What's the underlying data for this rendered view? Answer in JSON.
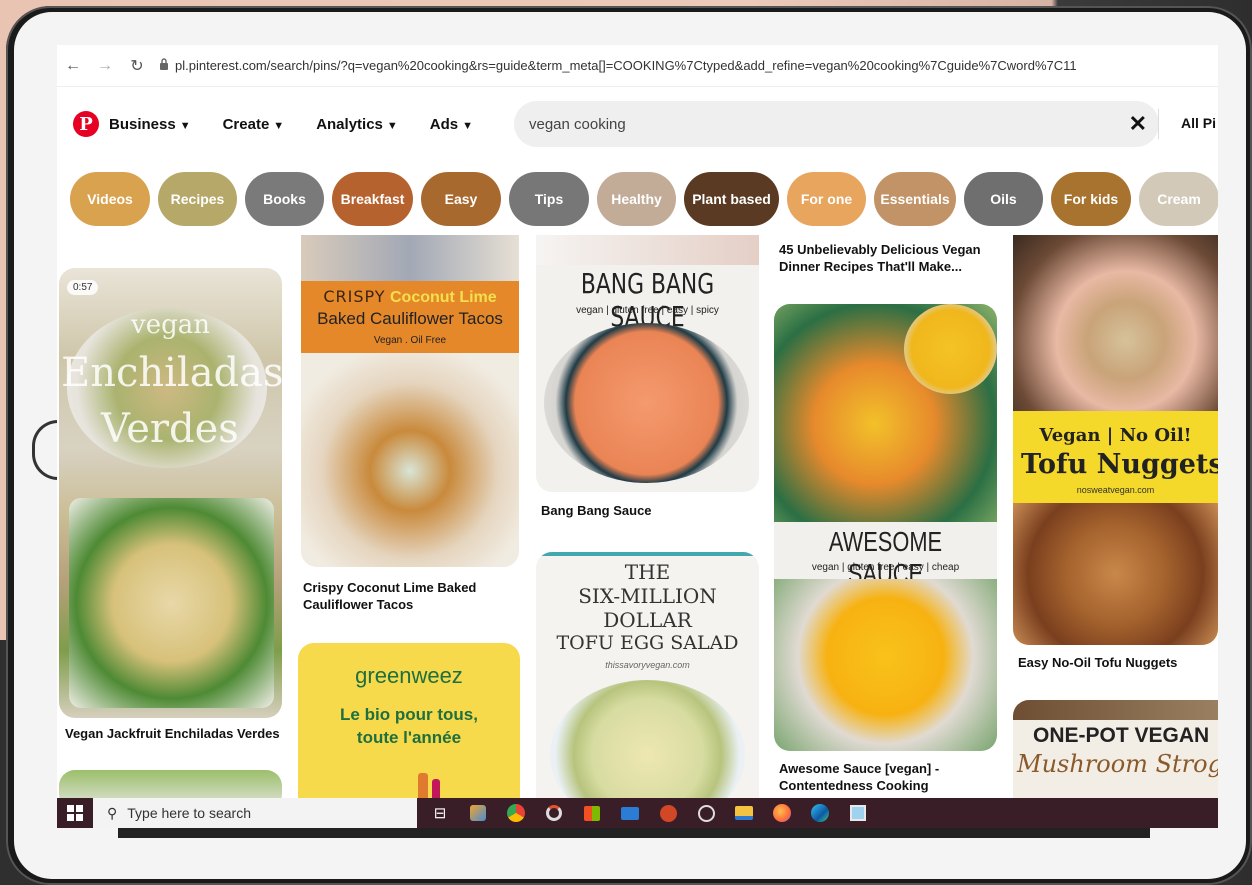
{
  "browser": {
    "url": "pl.pinterest.com/search/pins/?q=vegan%20cooking&rs=guide&term_meta[]=COOKING%7Ctyped&add_refine=vegan%20cooking%7Cguide%7Cword%7C11",
    "back": "←",
    "forward": "→",
    "reload": "↻"
  },
  "header": {
    "logo": "P",
    "menu": [
      "Business",
      "Create",
      "Analytics",
      "Ads"
    ],
    "search_value": "vegan cooking",
    "clear": "✕",
    "all_pins": "All Pi"
  },
  "chips": [
    {
      "label": "Videos",
      "color": "#d9a24f"
    },
    {
      "label": "Recipes",
      "color": "#b5a868"
    },
    {
      "label": "Books",
      "color": "#7a7a7a"
    },
    {
      "label": "Breakfast",
      "color": "#b5622e"
    },
    {
      "label": "Easy",
      "color": "#a8692f"
    },
    {
      "label": "Tips",
      "color": "#777777"
    },
    {
      "label": "Healthy",
      "color": "#c2ab97"
    },
    {
      "label": "Plant based",
      "color": "#5a3a22"
    },
    {
      "label": "For one",
      "color": "#e8a55e"
    },
    {
      "label": "Essentials",
      "color": "#c29366"
    },
    {
      "label": "Oils",
      "color": "#6f6f6f"
    },
    {
      "label": "For kids",
      "color": "#a8732f"
    },
    {
      "label": "Cream",
      "color": "#d3c9b9"
    }
  ],
  "pins": {
    "enchiladas": {
      "badge": "0:57",
      "overlay1": "vegan",
      "overlay2": "Enchiladas",
      "overlay3": "Verdes",
      "title": "Vegan Jackfruit Enchiladas Verdes"
    },
    "tacos": {
      "line1a": "CRISPY",
      "line1b": "Coconut Lime",
      "line2": "Baked Cauliflower Tacos",
      "line3": "Vegan . Oil Free",
      "title": "Crispy Coconut Lime Baked Cauliflower Tacos"
    },
    "ad": {
      "brand": "greenweez",
      "line1": "Le bio pour tous,",
      "line2": "toute l'année"
    },
    "bangbang": {
      "heading": "BANG BANG SAUCE",
      "sub": "vegan | gluten free | easy | spicy",
      "title": "Bang Bang Sauce"
    },
    "eggsalad": {
      "l1": "THE",
      "l2": "SIX-MILLION",
      "l3": "DOLLAR",
      "l4": "TOFU EGG SALAD",
      "site": "thissavoryvegan.com"
    },
    "dinner": {
      "title": "45 Unbelievably Delicious Vegan Dinner Recipes That'll Make..."
    },
    "awesome": {
      "heading": "AWESOME SAUCE",
      "sub": "vegan | gluten free | easy | cheap",
      "title": "Awesome Sauce [vegan] - Contentedness Cooking"
    },
    "nuggets": {
      "l1": "Vegan | No Oil!",
      "l2": "Tofu Nuggets",
      "site": "nosweatvegan.com",
      "title": "Easy No-Oil Tofu Nuggets"
    },
    "stroganoff": {
      "l1": "ONE-POT VEGAN",
      "l2": "Mushroom Stroganoff"
    }
  },
  "taskbar": {
    "search_placeholder": "Type here to search",
    "icons": [
      "task-view-icon",
      "app-icon",
      "chrome-icon",
      "app-icon-2",
      "store-icon",
      "mail-icon",
      "powerpoint-icon",
      "obs-icon",
      "file-explorer-icon",
      "firefox-icon",
      "edge-icon",
      "notepad-icon"
    ]
  }
}
